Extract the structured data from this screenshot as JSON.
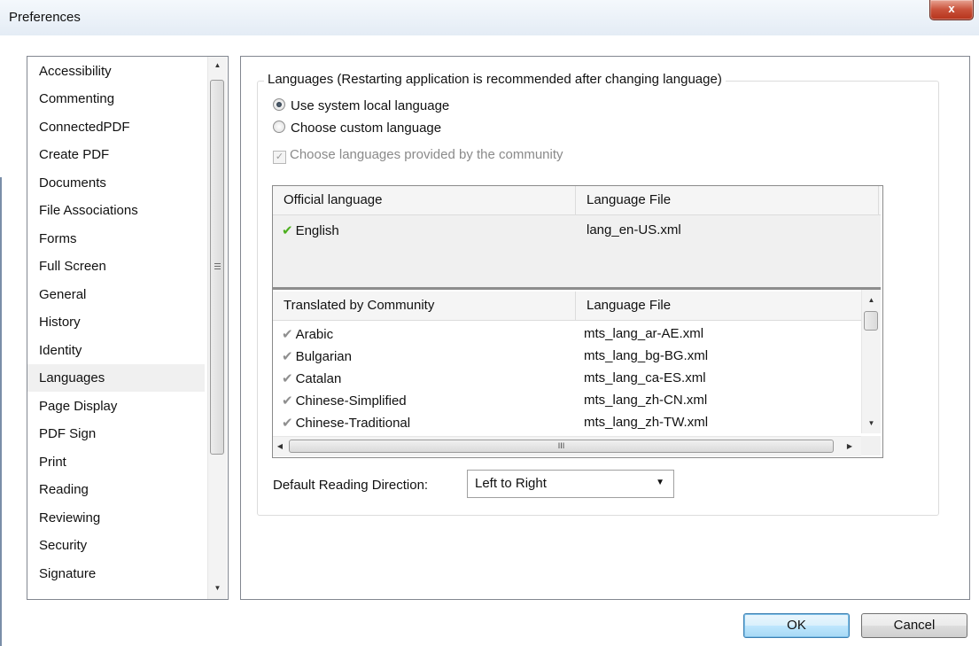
{
  "window": {
    "title": "Preferences",
    "close_glyph": "x"
  },
  "categories": [
    "Accessibility",
    "Commenting",
    "ConnectedPDF",
    "Create PDF",
    "Documents",
    "File Associations",
    "Forms",
    "Full Screen",
    "General",
    "History",
    "Identity",
    "Languages",
    "Page Display",
    "PDF Sign",
    "Print",
    "Reading",
    "Reviewing",
    "Security",
    "Signature"
  ],
  "selected_category": "Languages",
  "languages": {
    "group_title": "Languages (Restarting application is recommended after changing language)",
    "option_system": "Use system local language",
    "option_custom": "Choose custom language",
    "option_community": "Choose languages provided by the community",
    "selected_option": "Use system local language",
    "community_checked": true,
    "community_disabled": true
  },
  "official_table": {
    "headers": [
      "Official language",
      "Language File"
    ],
    "rows": [
      {
        "language": "English",
        "file": "lang_en-US.xml",
        "icon": "green-check-icon"
      }
    ]
  },
  "community_table": {
    "headers": [
      "Translated by Community",
      "Language File"
    ],
    "rows": [
      {
        "language": "Arabic",
        "file": "mts_lang_ar-AE.xml"
      },
      {
        "language": "Bulgarian",
        "file": "mts_lang_bg-BG.xml"
      },
      {
        "language": "Catalan",
        "file": "mts_lang_ca-ES.xml"
      },
      {
        "language": "Chinese-Simplified",
        "file": "mts_lang_zh-CN.xml"
      },
      {
        "language": "Chinese-Traditional",
        "file": "mts_lang_zh-TW.xml"
      }
    ]
  },
  "reading_direction": {
    "label": "Default Reading Direction:",
    "value": "Left to Right"
  },
  "buttons": {
    "ok": "OK",
    "cancel": "Cancel"
  },
  "colors": {
    "accent_check": "#4caf1e",
    "close_button": "#c9513a",
    "selected_row": "#f0f0f0"
  }
}
